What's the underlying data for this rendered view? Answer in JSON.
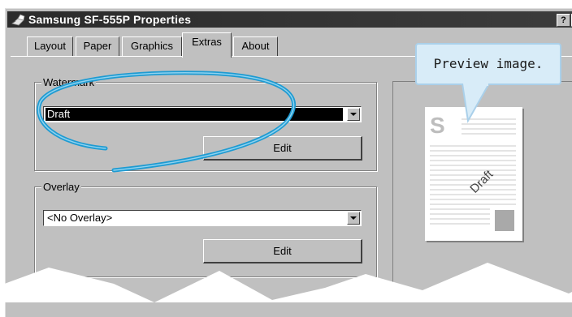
{
  "window": {
    "title": "Samsung SF-555P Properties",
    "help_button": "?",
    "close_button": ""
  },
  "tabs": [
    {
      "label": "Layout"
    },
    {
      "label": "Paper"
    },
    {
      "label": "Graphics"
    },
    {
      "label": "Extras"
    },
    {
      "label": "About"
    }
  ],
  "watermark": {
    "label": "Watermark",
    "selected": "Draft",
    "edit_label": "Edit"
  },
  "overlay": {
    "label": "Overlay",
    "selected": "<No Overlay>",
    "edit_label": "Edit"
  },
  "preview": {
    "callout": "Preview image.",
    "logo_letter": "S",
    "watermark_text": "Draft"
  },
  "colors": {
    "callout_fill": "#d8ecf8",
    "highlight_ellipse": "#1e9bd2"
  },
  "icons": [
    "printer-icon",
    "chevron-down-icon",
    "help-icon"
  ]
}
